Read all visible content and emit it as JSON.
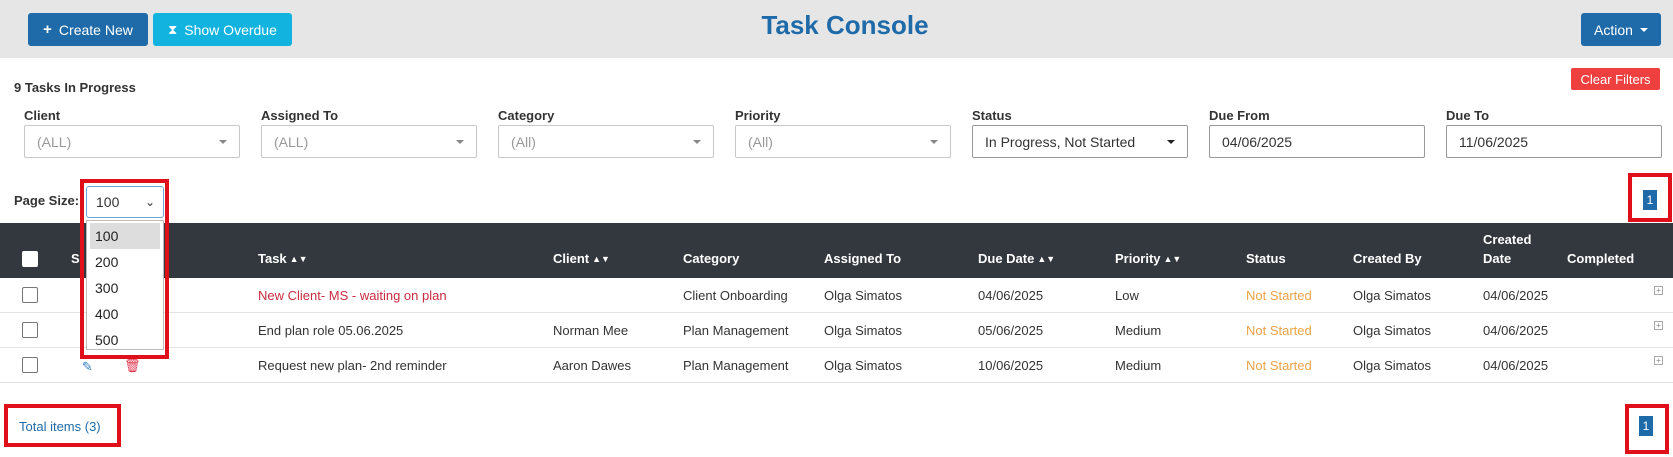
{
  "header": {
    "title": "Task Console",
    "create_new_label": "Create New",
    "show_overdue_label": "Show Overdue",
    "action_label": "Action"
  },
  "summary": {
    "tasks_in_progress": "9 Tasks In Progress",
    "clear_filters_label": "Clear Filters"
  },
  "filters": [
    {
      "label": "Client",
      "value": "(ALL)"
    },
    {
      "label": "Assigned To",
      "value": "(ALL)"
    },
    {
      "label": "Category",
      "value": "(All)"
    },
    {
      "label": "Priority",
      "value": "(All)"
    },
    {
      "label": "Status",
      "value": "In Progress, Not Started"
    },
    {
      "label": "Due From",
      "value": "04/06/2025"
    },
    {
      "label": "Due To",
      "value": "11/06/2025"
    }
  ],
  "page_size": {
    "label": "Page Size:",
    "selected": "100",
    "options": [
      "100",
      "200",
      "300",
      "400",
      "500"
    ]
  },
  "pagination": {
    "top_page": "1",
    "bottom_page": "1",
    "total_items": "Total items (3)"
  },
  "table": {
    "columns": {
      "select": "S",
      "task": "Task",
      "client": "Client",
      "category": "Category",
      "assigned_to": "Assigned To",
      "due_date": "Due Date",
      "priority": "Priority",
      "status": "Status",
      "created_by": "Created By",
      "created_date_line1": "Created",
      "created_date_line2": "Date",
      "completed": "Completed"
    },
    "rows": [
      {
        "task": "New Client- MS - waiting on plan",
        "client": "",
        "category": "Client Onboarding",
        "assigned_to": "Olga Simatos",
        "due_date": "04/06/2025",
        "priority": "Low",
        "status": "Not Started",
        "created_by": "Olga Simatos",
        "created_date": "04/06/2025"
      },
      {
        "task": "End plan role 05.06.2025",
        "client": "Norman Mee",
        "category": "Plan Management",
        "assigned_to": "Olga Simatos",
        "due_date": "05/06/2025",
        "priority": "Medium",
        "status": "Not Started",
        "created_by": "Olga Simatos",
        "created_date": "04/06/2025"
      },
      {
        "task": "Request new plan- 2nd reminder",
        "client": "Aaron Dawes",
        "category": "Plan Management",
        "assigned_to": "Olga Simatos",
        "due_date": "10/06/2025",
        "priority": "Medium",
        "status": "Not Started",
        "created_by": "Olga Simatos",
        "created_date": "04/06/2025"
      }
    ]
  },
  "colors": {
    "primary": "#1f6aa8",
    "info": "#12b3df",
    "danger": "#ef4040",
    "highlight_box": "#e0101a",
    "status_not_started": "#eba347",
    "overdue_task": "#c92b3f"
  }
}
